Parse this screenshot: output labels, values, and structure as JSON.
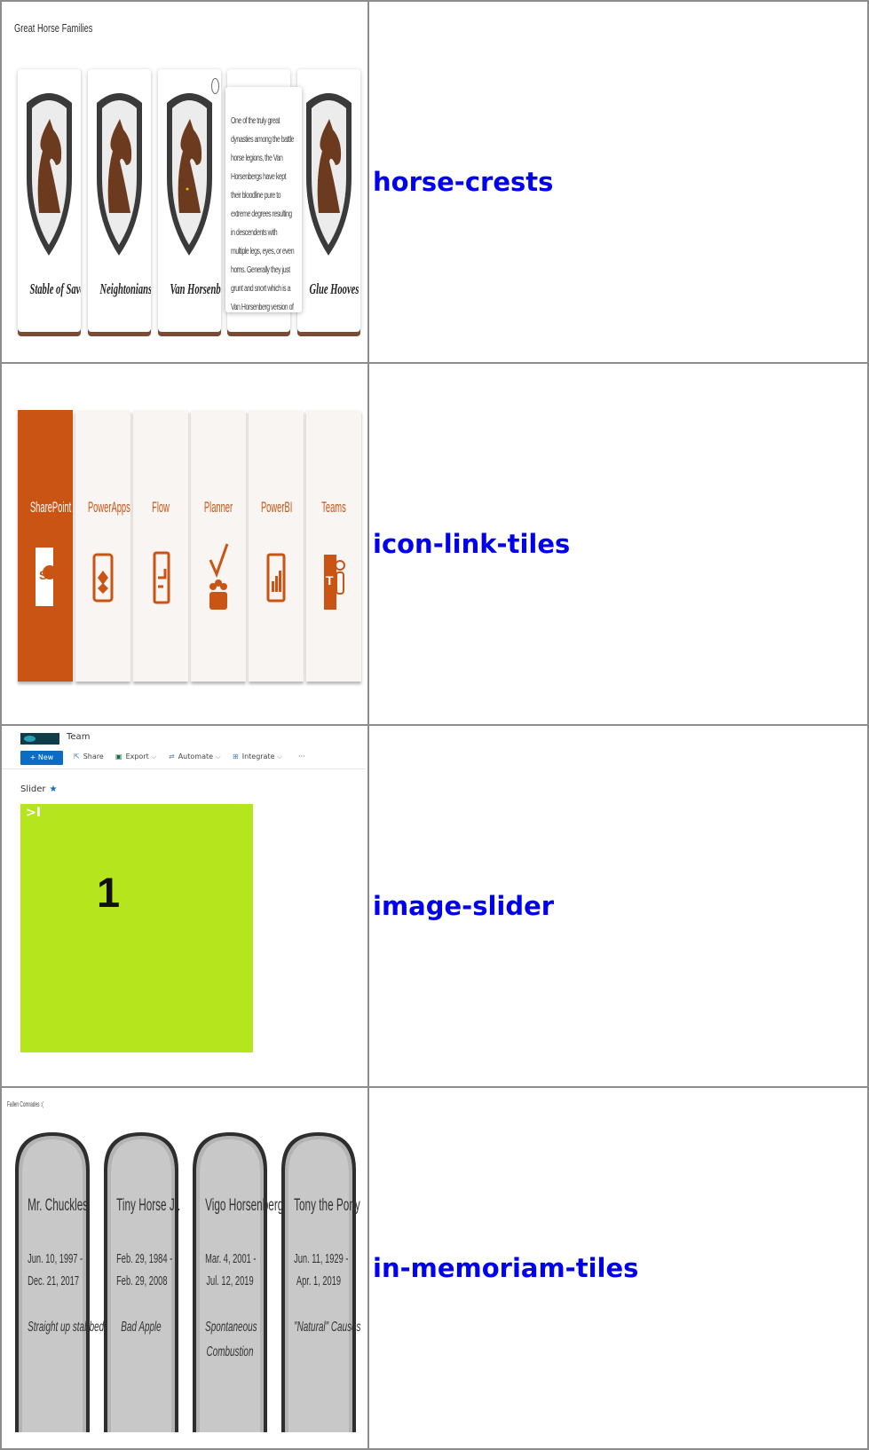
{
  "rows": [
    {
      "link": "horse-crests"
    },
    {
      "link": "icon-link-tiles"
    },
    {
      "link": "image-slider"
    },
    {
      "link": "in-memoriam-tiles"
    }
  ],
  "horse_crests": {
    "title": "Great Horse Families",
    "cards": [
      {
        "name": "Stable of Savoy"
      },
      {
        "name": "Neightonians"
      },
      {
        "name": "Van Horsenbergs"
      },
      {
        "name": ""
      },
      {
        "name": "Glue Hooves"
      }
    ],
    "tooltip": "One of the truly great dynasties among the battle horse legions, the Van Horsenbergs have kept their bloodline pure to extreme degrees resulting in descendents with multiple legs, eyes, or even horns. Generally they just grunt and snort which is a Van Horsenberg version of a neigh. Lovable mutants really.",
    "colors": {
      "shield": "#3a3a3a",
      "horse": "#6b3a1f",
      "base": "#7b4a34"
    }
  },
  "icon_tiles": {
    "accent": "#c95414",
    "tiles": [
      {
        "label": "SharePoint",
        "icon": "sharepoint-icon",
        "active": true
      },
      {
        "label": "PowerApps",
        "icon": "powerapps-icon",
        "active": false
      },
      {
        "label": "Flow",
        "icon": "flow-icon",
        "active": false
      },
      {
        "label": "Planner",
        "icon": "planner-icon",
        "active": false
      },
      {
        "label": "PowerBI",
        "icon": "powerbi-icon",
        "active": false
      },
      {
        "label": "Teams",
        "icon": "teams-icon",
        "active": false
      }
    ]
  },
  "image_slider": {
    "site_name": "Team",
    "commands": {
      "new": "+ New",
      "share": "Share",
      "export": "Export",
      "automate": "Automate",
      "integrate": "Integrate",
      "more": "···"
    },
    "page_title": "Slider",
    "star": "★",
    "next_glyph": ">I",
    "slide_number": "1",
    "slide_color": "#b5e61d"
  },
  "in_memoriam": {
    "title": "Fallen Comrades :(",
    "stones": [
      {
        "name": "Mr. Chuckles",
        "born": "Jun. 10, 1997 -",
        "died": "Dec. 21, 2017",
        "cause1": "Straight up stabbed",
        "cause2": ""
      },
      {
        "name": "Tiny Horse Jr.",
        "born": "Feb. 29, 1984 -",
        "died": "Feb. 29, 2008",
        "cause1": "Bad Apple",
        "cause2": ""
      },
      {
        "name": "Vigo Horsenberg",
        "born": "Mar. 4, 2001 -",
        "died": "Jul. 12, 2019",
        "cause1": "Spontaneous",
        "cause2": "Combustion"
      },
      {
        "name": "Tony the Pony",
        "born": "Jun. 11, 1929 -",
        "died": "Apr. 1, 2019",
        "cause1": "\"Natural\" Causes",
        "cause2": ""
      }
    ]
  }
}
